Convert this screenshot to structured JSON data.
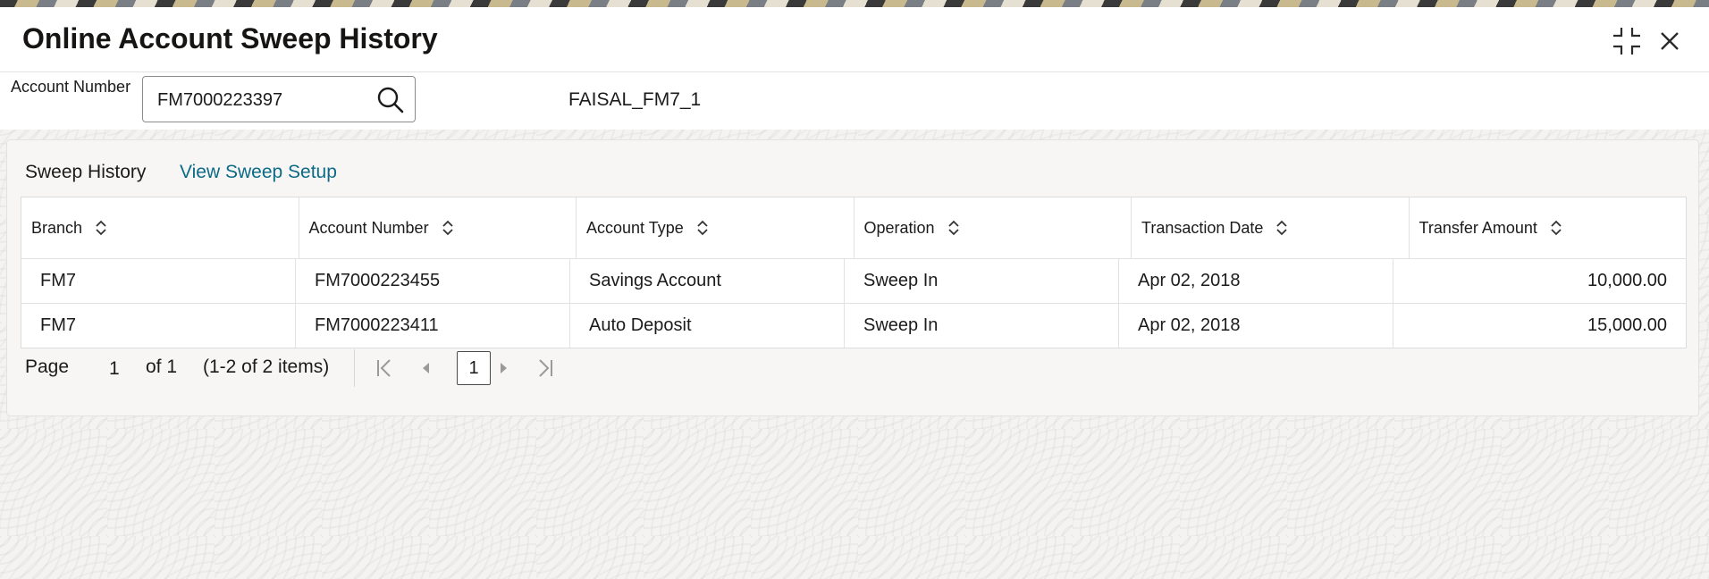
{
  "header": {
    "title": "Online Account Sweep History"
  },
  "account": {
    "label": "Account Number",
    "value": "FM7000223397",
    "name": "FAISAL_FM7_1"
  },
  "tabs": {
    "active": "Sweep History",
    "link": "View Sweep Setup"
  },
  "table": {
    "columns": [
      "Branch",
      "Account Number",
      "Account Type",
      "Operation",
      "Transaction Date",
      "Transfer Amount"
    ],
    "rows": [
      [
        "FM7",
        "FM7000223455",
        "Savings Account",
        "Sweep In",
        "Apr 02, 2018",
        "10,000.00"
      ],
      [
        "FM7",
        "FM7000223411",
        "Auto Deposit",
        "Sweep In",
        "Apr 02, 2018",
        "15,000.00"
      ]
    ]
  },
  "pager": {
    "page_label": "Page",
    "current": "1",
    "of_label": "of 1",
    "items_label": "(1-2 of 2 items)",
    "page_button": "1"
  },
  "icons": {
    "minimize": "minimize-icon",
    "close": "close-icon",
    "search": "search-icon",
    "sort": "sort-icon",
    "first": "first-page-icon",
    "prev": "prev-page-icon",
    "next": "next-page-icon",
    "last": "last-page-icon"
  },
  "colors": {
    "link": "#0b6b87",
    "title": "#161513"
  }
}
